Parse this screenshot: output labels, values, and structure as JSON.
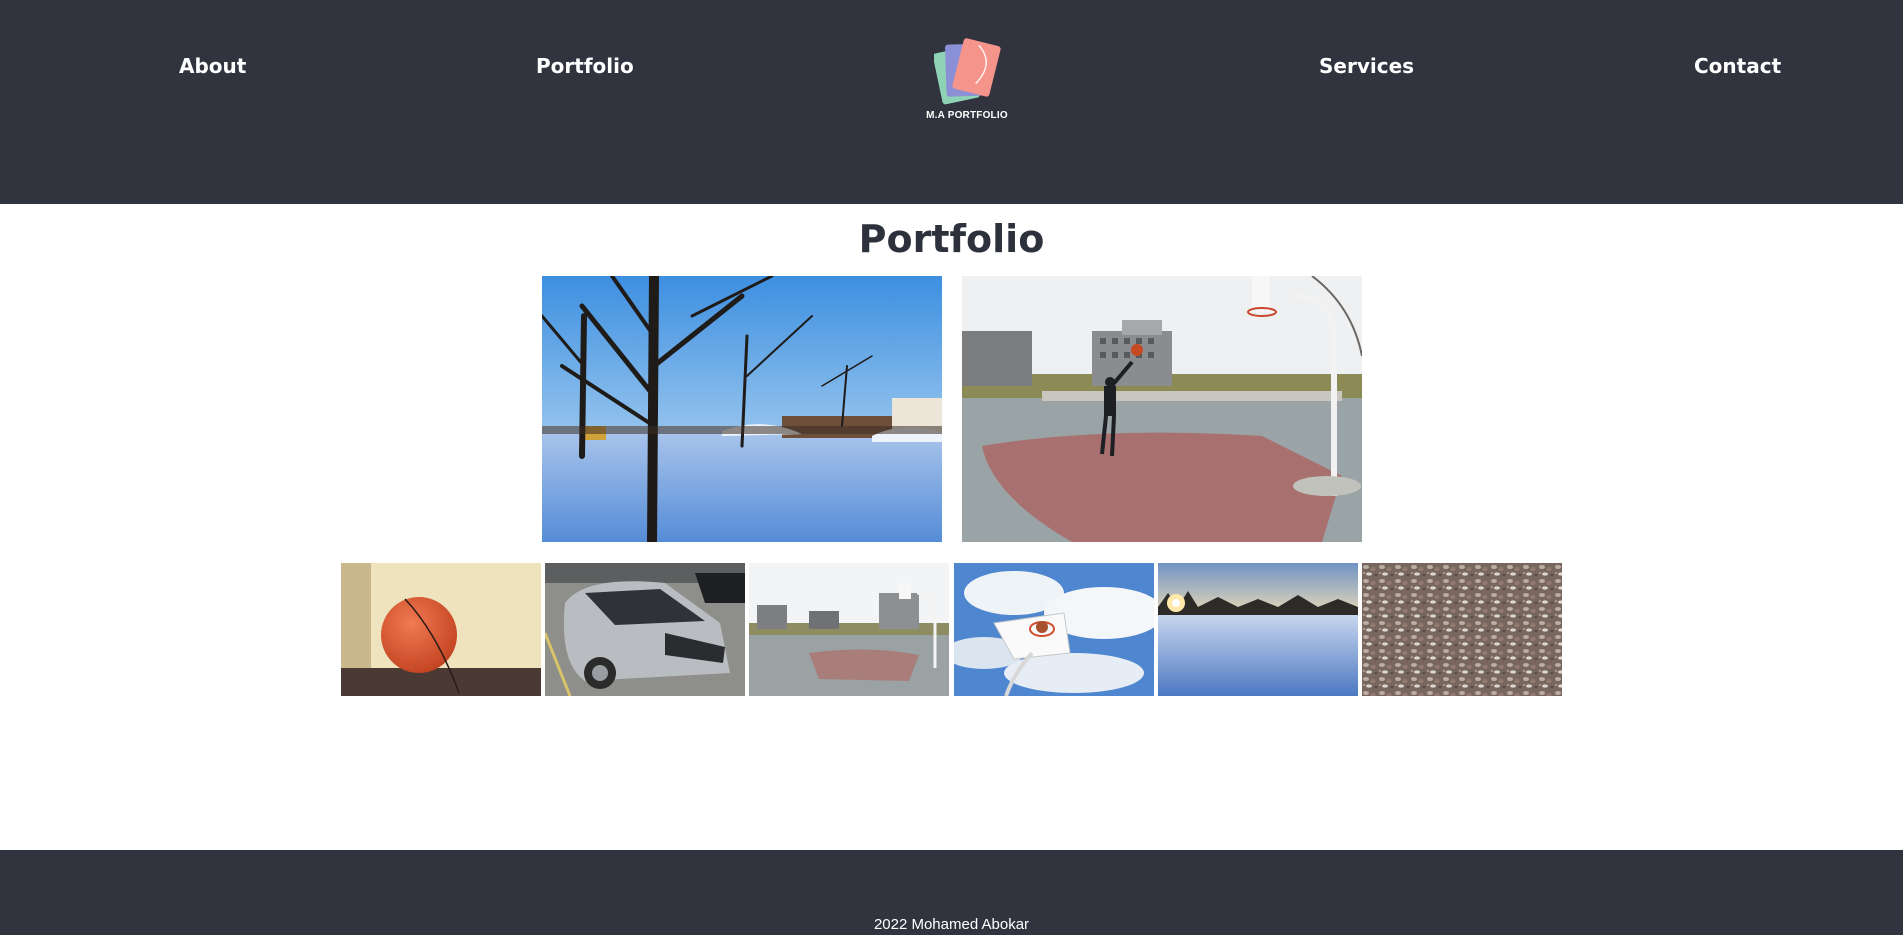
{
  "header": {
    "nav": {
      "about": "About",
      "portfolio": "Portfolio",
      "services": "Services",
      "contact": "Contact"
    },
    "logo": {
      "text": "M.A PORTFOLIO",
      "colors": [
        "#8fd3b6",
        "#8b8fd6",
        "#f4948a"
      ]
    },
    "background": "#31343f"
  },
  "main": {
    "title": "Portfolio",
    "featured_photos": [
      {
        "subject": "snowy park with bare trees"
      },
      {
        "subject": "person shooting basketball on outdoor court"
      }
    ],
    "thumbnails": [
      {
        "subject": "orange ball close-up"
      },
      {
        "subject": "silver SUV in parking lot"
      },
      {
        "subject": "outdoor basketball court"
      },
      {
        "subject": "basketball hoop against cloudy sky"
      },
      {
        "subject": "snowy field at sunset"
      },
      {
        "subject": "pebbles and ice texture"
      }
    ]
  },
  "footer": {
    "text": "2022 Mohamed Abokar"
  }
}
